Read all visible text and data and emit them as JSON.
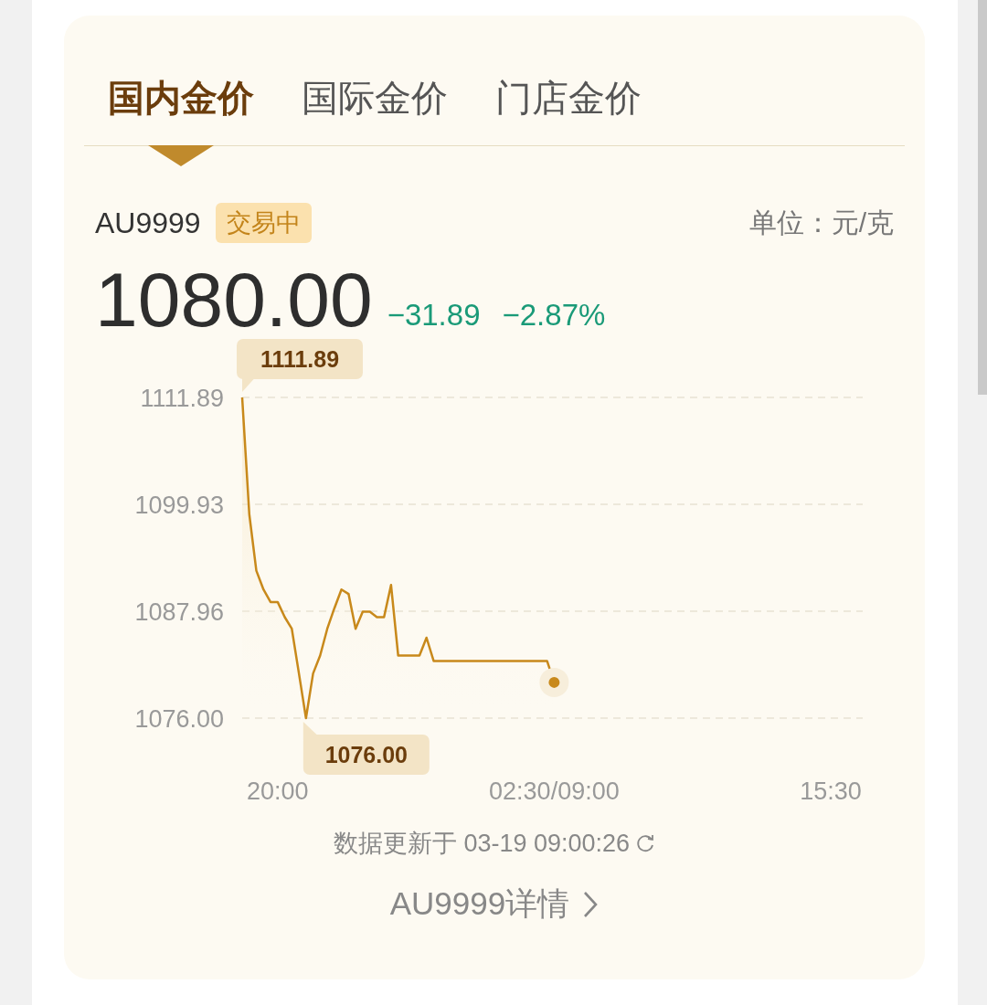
{
  "tabs": [
    {
      "label": "国内金价",
      "selected": true
    },
    {
      "label": "国际金价",
      "selected": false
    },
    {
      "label": "门店金价",
      "selected": false
    }
  ],
  "quote": {
    "symbol": "AU9999",
    "status": "交易中",
    "unit": "单位：元/克",
    "price": "1080.00",
    "change": "−31.89",
    "change_percent": "−2.87%"
  },
  "chart": {
    "chart_data": {
      "type": "line",
      "categories": [
        null,
        null,
        null,
        null,
        null,
        "20:00",
        null,
        null,
        null,
        null,
        null,
        null,
        null,
        null,
        null,
        null,
        null,
        null,
        null,
        null,
        null,
        null,
        null,
        null,
        null,
        null,
        null,
        null,
        null,
        null,
        null,
        null,
        null,
        null,
        null,
        null,
        null,
        null,
        null,
        null,
        null,
        null,
        null,
        null,
        "02:30/09:00",
        null,
        null,
        null,
        null,
        null,
        null,
        null,
        null,
        null,
        null,
        null,
        null,
        null,
        null,
        null,
        null,
        null,
        null,
        null,
        null,
        null,
        null,
        null,
        null,
        null,
        null,
        null,
        null,
        null,
        null,
        null,
        null,
        null,
        null,
        null,
        null,
        null,
        null,
        "15:30"
      ],
      "ylim": [
        1076.0,
        1111.89
      ],
      "yticks": [
        {
          "value": 1111.89,
          "label": "1111.89"
        },
        {
          "value": 1099.93,
          "label": "1099.93"
        },
        {
          "value": 1087.96,
          "label": "1087.96"
        },
        {
          "value": 1076.0,
          "label": "1076.00"
        }
      ],
      "series": [
        {
          "color": "#c8891b",
          "values": [
            1111.89,
            1098.8,
            1092.5,
            1090.4,
            1089.0,
            1089.0,
            1087.3,
            1086.0,
            1081.0,
            1076.0,
            1081.0,
            1083.0,
            1086.0,
            1088.3,
            1090.4,
            1089.9,
            1086.0,
            1087.9,
            1087.9,
            1087.3,
            1087.3,
            1090.9,
            1083.0,
            1083.0,
            1083.0,
            1083.0,
            1085.0,
            1082.4,
            1082.4,
            1082.4,
            1082.4,
            1082.4,
            1082.4,
            1082.4,
            1082.4,
            1082.4,
            1082.4,
            1082.4,
            1082.4,
            1082.4,
            1082.4,
            1082.4,
            1082.4,
            1082.4,
            1080.0,
            null,
            null,
            null,
            null,
            null,
            null,
            null,
            null,
            null,
            null,
            null,
            null,
            null,
            null,
            null,
            null,
            null,
            null,
            null,
            null,
            null,
            null,
            null,
            null,
            null,
            null,
            null,
            null,
            null,
            null,
            null,
            null,
            null,
            null,
            null,
            null,
            null,
            null,
            null
          ]
        }
      ],
      "annotations": [
        "1111.89",
        "1076.00"
      ]
    }
  },
  "footer": {
    "updated": "数据更新于 03-19 09:00:26",
    "details_link": "AU9999详情"
  }
}
